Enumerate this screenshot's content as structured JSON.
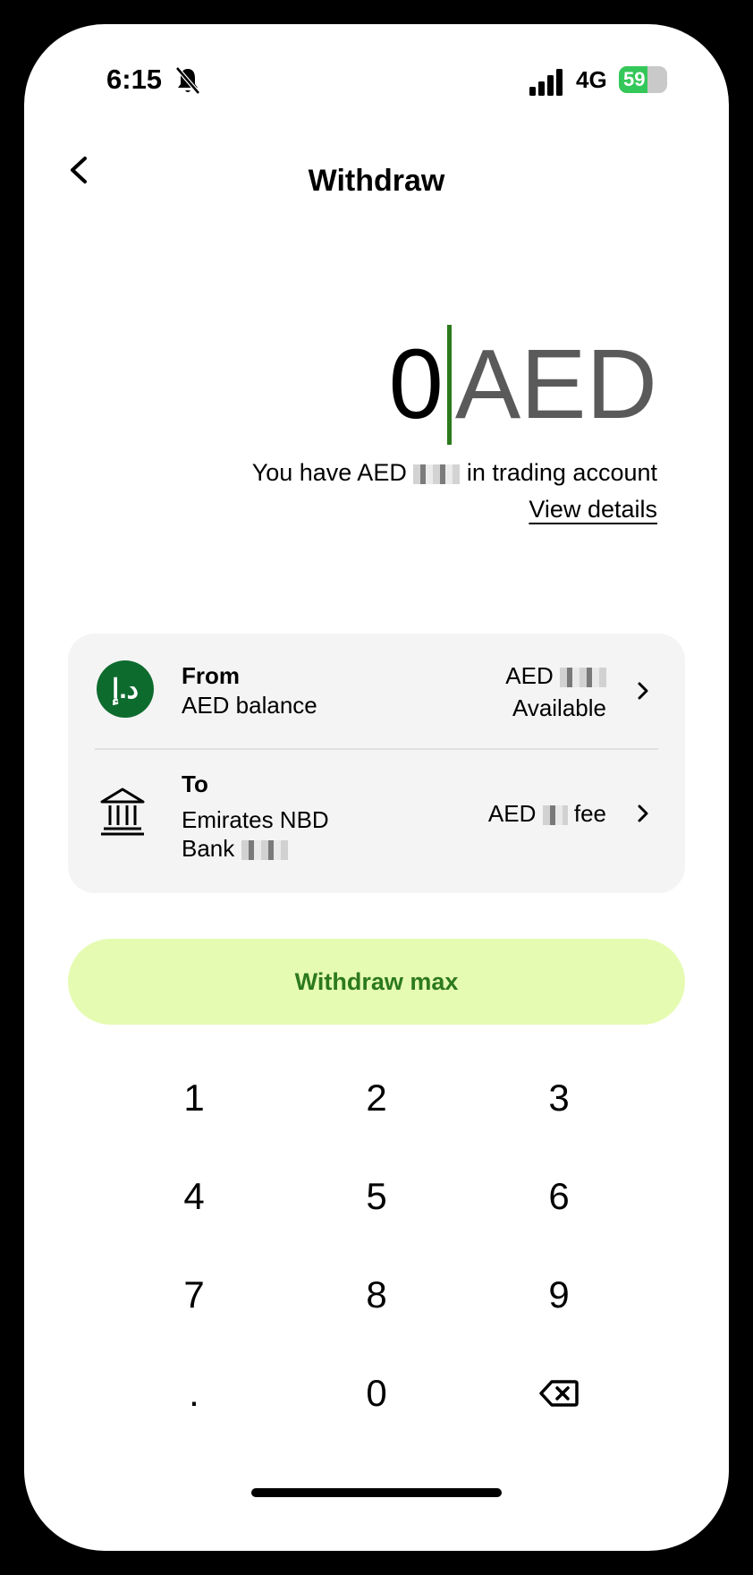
{
  "status_bar": {
    "time": "6:15",
    "network": "4G",
    "battery": "59",
    "battery_level": 0.59
  },
  "header": {
    "title": "Withdraw"
  },
  "amount": {
    "value": "0",
    "currency": "AED",
    "balance_prefix": "You have AED",
    "balance_suffix": "in trading account",
    "view_details": "View details"
  },
  "from": {
    "label": "From",
    "account": "AED balance",
    "amount_prefix": "AED",
    "amount_caption": "Available",
    "icon_text": "د.إ"
  },
  "to": {
    "label": "To",
    "bank_line1": "Emirates NBD",
    "bank_line2": "Bank",
    "fee_prefix": "AED",
    "fee_suffix": "fee"
  },
  "withdraw_max": {
    "label": "Withdraw max"
  },
  "keypad": {
    "keys": [
      "1",
      "2",
      "3",
      "4",
      "5",
      "6",
      "7",
      "8",
      "9",
      ".",
      "0",
      "⌫"
    ]
  },
  "colors": {
    "accent_green": "#2c7a1d",
    "button_bg": "#e6fbb2",
    "icon_green": "#0e6b2e"
  }
}
